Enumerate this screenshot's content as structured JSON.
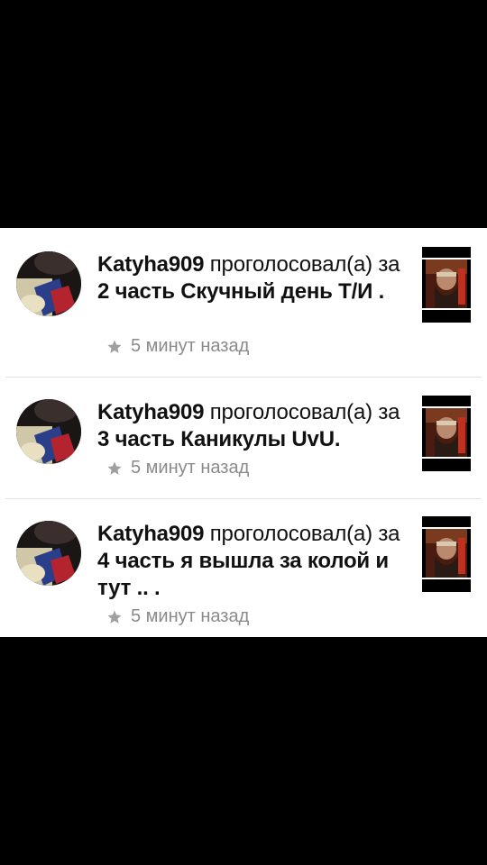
{
  "feed": {
    "items": [
      {
        "user": "Katyha909",
        "action": " проголосовал(а) за ",
        "part": "2 часть",
        "title": " Скучный день Т/И",
        "tail": " .",
        "time": "5 минут назад",
        "time_icon": "star-icon"
      },
      {
        "user": "Katyha909",
        "action": " проголосовал(а) за ",
        "part": "3 часть",
        "title": " Каникулы UvU",
        "tail": ".",
        "time": "5 минут назад",
        "time_icon": "star-icon"
      },
      {
        "user": "Katyha909",
        "action": " проголосовал(а) за ",
        "part": "4 часть",
        "title": " я вышла за колой и тут ..",
        "tail": " .",
        "time": "5 минут назад",
        "time_icon": "star-icon"
      }
    ]
  },
  "colors": {
    "background": "#000000",
    "card": "#ffffff",
    "text": "#111111",
    "meta_text": "#8a8a8a",
    "divider": "#e2e2e2"
  }
}
